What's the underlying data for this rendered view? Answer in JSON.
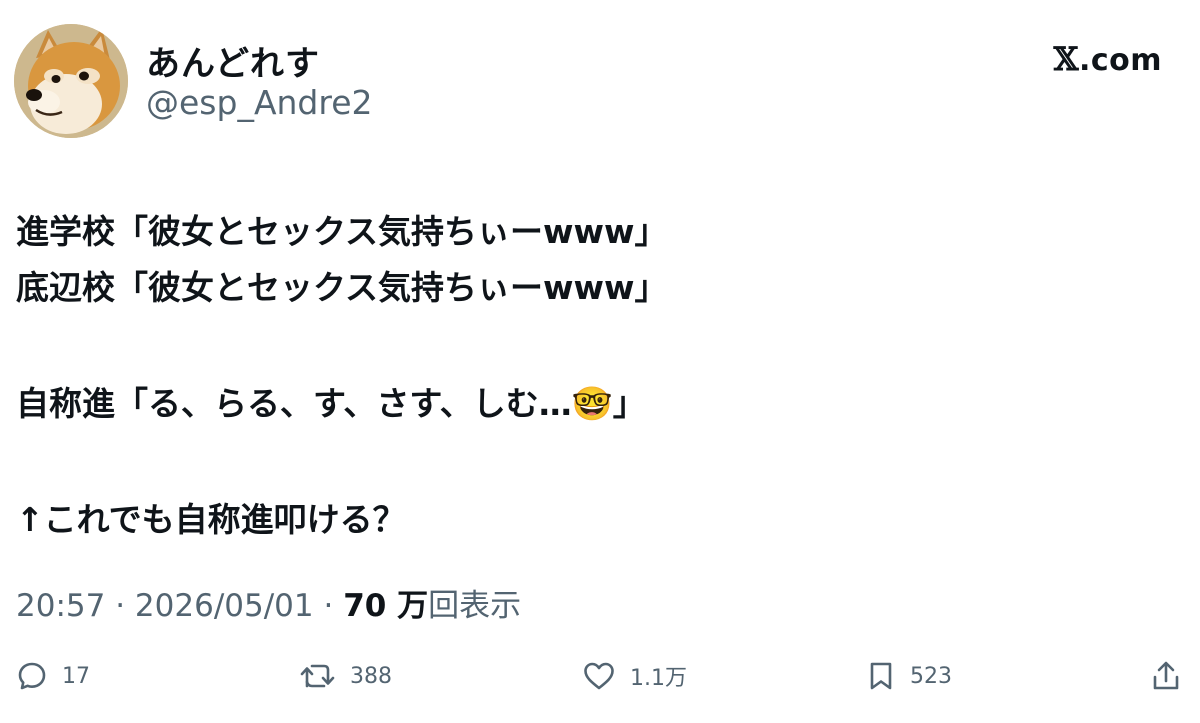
{
  "header": {
    "display_name": "あんどれす",
    "handle": "@esp_Andre2",
    "brand_mark": "𝕏",
    "brand_suffix": ".com"
  },
  "tweet": {
    "lines": [
      "進学校「彼女とセックス気持ちぃーwww」",
      "底辺校「彼女とセックス気持ちぃーwww」",
      "",
      "自称進「る、らる、す、さす、しむ…🤓」",
      "",
      "↑これでも自称進叩ける？"
    ]
  },
  "meta": {
    "time": "20:57",
    "separator": "·",
    "date": "2026/05/01",
    "views_count": "70 万",
    "views_label": "回表示"
  },
  "actions": {
    "reply_count": "17",
    "retweet_count": "388",
    "like_count": "1.1万",
    "bookmark_count": "523"
  },
  "icons": {
    "avatar": "shiba-inu-avatar",
    "reply": "reply-bubble-icon",
    "retweet": "retweet-icon",
    "like": "heart-icon",
    "bookmark": "bookmark-icon",
    "share": "share-icon"
  },
  "colors": {
    "text": "#0f1419",
    "secondary": "#536471",
    "background": "#ffffff"
  }
}
